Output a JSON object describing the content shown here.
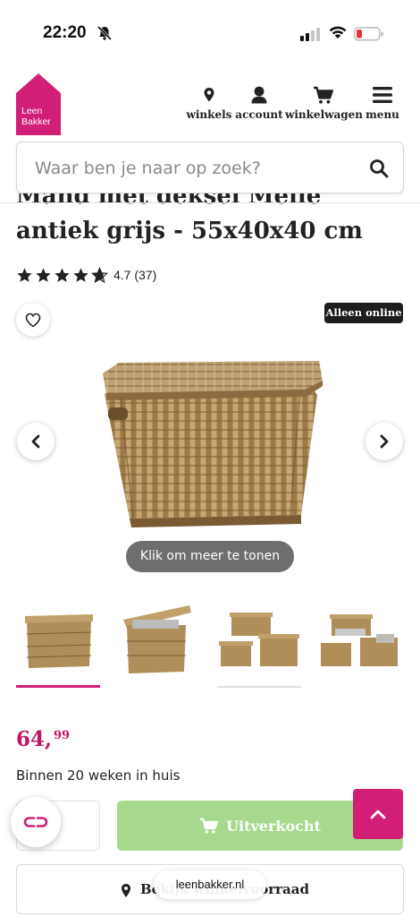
{
  "status_bar": {
    "time": "22:20"
  },
  "header": {
    "logo_line1": "Leen",
    "logo_line2": "Bakker",
    "nav": [
      {
        "label": "winkels",
        "icon": "location-pin-icon"
      },
      {
        "label": "account",
        "icon": "user-icon"
      },
      {
        "label": "winkelwagen",
        "icon": "cart-icon"
      },
      {
        "label": "menu",
        "icon": "hamburger-icon"
      }
    ]
  },
  "search": {
    "placeholder": "Waar ben je naar op zoek?"
  },
  "product": {
    "title_line1": "Mand met deksel Melle",
    "title_line2": "antiek grijs - 55x40x40 cm",
    "rating_value": 4.7,
    "rating_text": "4.7 (37)",
    "badge": "Alleen online",
    "more_label": "Klik om meer te tonen",
    "price_main": "64,",
    "price_cents": "99",
    "delivery": "Binnen 20 weken in huis",
    "soldout_label": "Uitverkocht",
    "stock_label": "Bekijk winkelvoorraad",
    "thumbnail_count": 4,
    "active_thumbnail": 1
  },
  "browser": {
    "url": "leenbakker.nl"
  },
  "colors": {
    "brand": "#d11e77",
    "price": "#c2146b",
    "soldout": "#a6d98d",
    "badge": "#1d1d1d",
    "more_button": "#6e6e6e"
  }
}
